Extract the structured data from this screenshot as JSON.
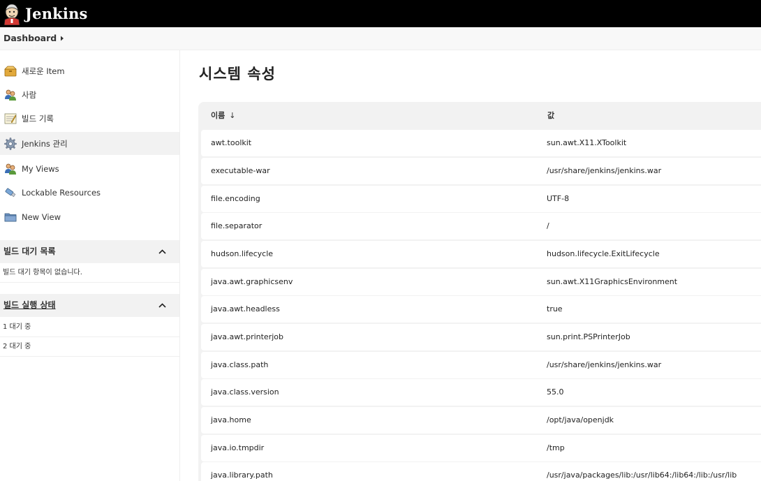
{
  "header": {
    "brand": "Jenkins"
  },
  "breadcrumb": {
    "items": [
      {
        "label": "Dashboard"
      }
    ]
  },
  "sidebar": {
    "tasks": [
      {
        "label": "새로운 Item",
        "icon": "new-item-icon"
      },
      {
        "label": "사람",
        "icon": "people-icon"
      },
      {
        "label": "빌드 기록",
        "icon": "build-history-icon"
      },
      {
        "label": "Jenkins 관리",
        "icon": "gear-icon",
        "active": true
      },
      {
        "label": "My Views",
        "icon": "people-icon"
      },
      {
        "label": "Lockable Resources",
        "icon": "usb-icon"
      },
      {
        "label": "New View",
        "icon": "folder-icon"
      }
    ],
    "build_queue": {
      "title": "빌드 대기 목록",
      "empty_text": "빌드 대기 항목이 없습니다."
    },
    "executors": {
      "title": "빌드 실행 상태",
      "items": [
        {
          "text": "1  대기 중"
        },
        {
          "text": "2  대기 중"
        }
      ]
    }
  },
  "main": {
    "title": "시스템 속성",
    "table": {
      "columns": [
        {
          "label": "이름",
          "sort_indicator": "↓"
        },
        {
          "label": "값"
        }
      ],
      "rows": [
        {
          "name": "awt.toolkit",
          "value": "sun.awt.X11.XToolkit"
        },
        {
          "name": "executable-war",
          "value": "/usr/share/jenkins/jenkins.war"
        },
        {
          "name": "file.encoding",
          "value": "UTF-8"
        },
        {
          "name": "file.separator",
          "value": "/"
        },
        {
          "name": "hudson.lifecycle",
          "value": "hudson.lifecycle.ExitLifecycle"
        },
        {
          "name": "java.awt.graphicsenv",
          "value": "sun.awt.X11GraphicsEnvironment"
        },
        {
          "name": "java.awt.headless",
          "value": "true"
        },
        {
          "name": "java.awt.printerjob",
          "value": "sun.print.PSPrinterJob"
        },
        {
          "name": "java.class.path",
          "value": "/usr/share/jenkins/jenkins.war"
        },
        {
          "name": "java.class.version",
          "value": "55.0"
        },
        {
          "name": "java.home",
          "value": "/opt/java/openjdk"
        },
        {
          "name": "java.io.tmpdir",
          "value": "/tmp"
        },
        {
          "name": "java.library.path",
          "value": "/usr/java/packages/lib:/usr/lib64:/lib64:/lib:/usr/lib"
        }
      ]
    }
  }
}
